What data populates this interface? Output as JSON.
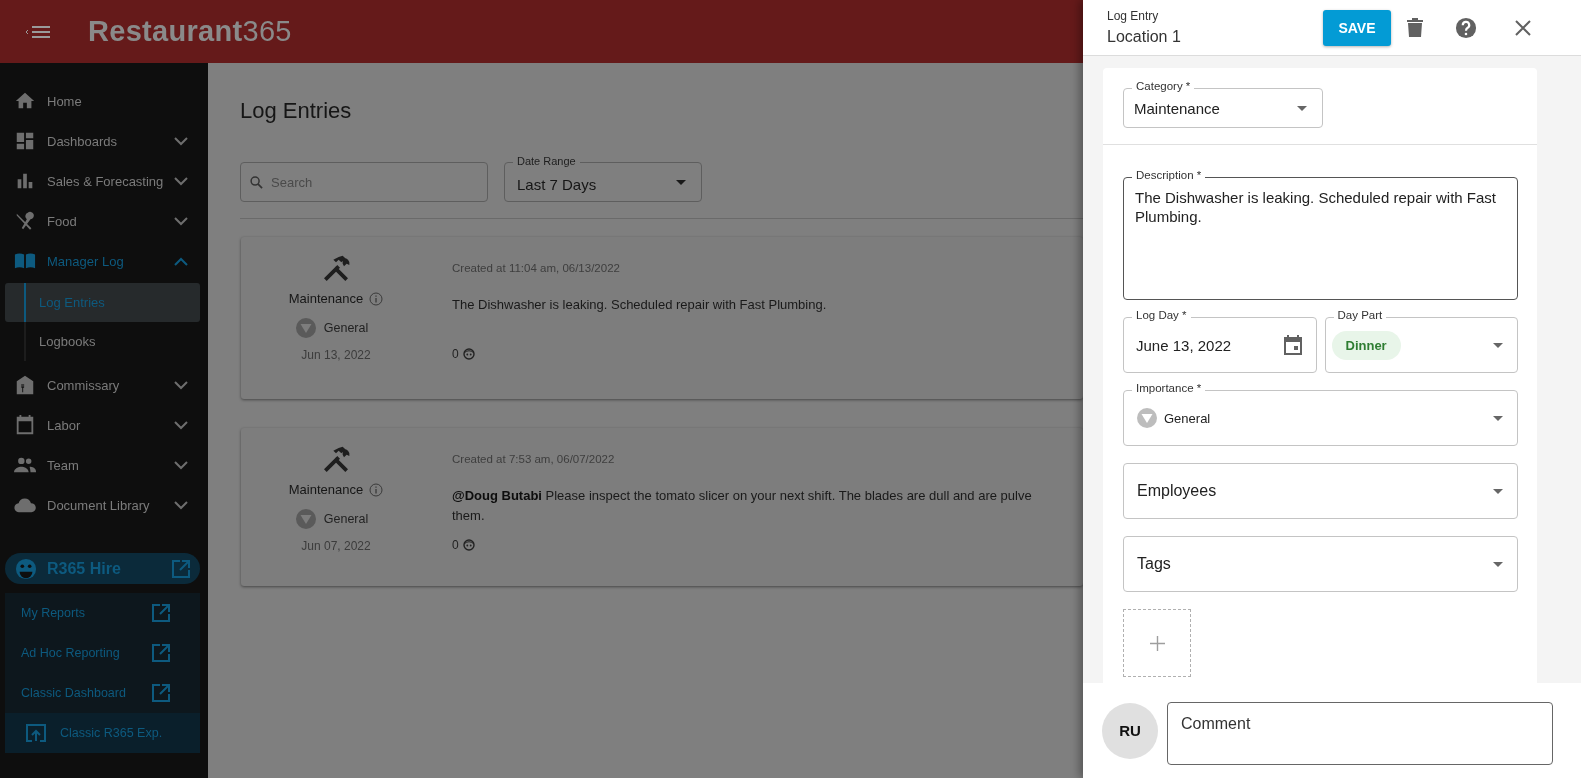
{
  "header": {
    "logo": "**Restaurant**365"
  },
  "sidebar": {
    "items": [
      {
        "label": "Home",
        "kind": "link",
        "selected": false
      },
      {
        "label": "Dashboards",
        "kind": "group",
        "expanded": false,
        "selected": false
      },
      {
        "label": "Sales & Forecasting",
        "kind": "group",
        "expanded": false,
        "selected": false
      },
      {
        "label": "Food",
        "kind": "group",
        "expanded": false,
        "selected": false
      },
      {
        "label": "Manager Log",
        "kind": "group",
        "expanded": true,
        "selected": true,
        "children": [
          {
            "label": "Log Entries",
            "selected": true
          },
          {
            "label": "Logbooks",
            "selected": false
          }
        ]
      },
      {
        "label": "Commissary",
        "kind": "group",
        "expanded": false,
        "selected": false
      },
      {
        "label": "Labor",
        "kind": "group",
        "expanded": false,
        "selected": false
      },
      {
        "label": "Team",
        "kind": "group",
        "expanded": false,
        "selected": false
      },
      {
        "label": "Document Library",
        "kind": "group",
        "expanded": false,
        "selected": false
      }
    ],
    "hire": {
      "label": "R365 Hire"
    },
    "links": [
      {
        "label": "My Reports"
      },
      {
        "label": "Ad Hoc Reporting"
      },
      {
        "label": "Classic Dashboard"
      }
    ],
    "classic": {
      "label": "Classic R365 Exp."
    }
  },
  "main": {
    "title": "Log Entries",
    "search": {
      "placeholder": "Search"
    },
    "date_range": {
      "label": "Date Range",
      "value": "Last 7 Days"
    },
    "entries": [
      {
        "category": "Maintenance",
        "importance": "General",
        "date": "Jun 13, 2022",
        "created": "Created at 11:04 am, 06/13/2022",
        "message_lines": [
          "The Dishwasher is leaking. Scheduled repair with Fast Plumbing."
        ],
        "comments": "0"
      },
      {
        "category": "Maintenance",
        "importance": "General",
        "date": "Jun 07, 2022",
        "created": "Created at 7:53 am, 06/07/2022",
        "message_lines": [
          "**@Doug Butabi** Please inspect the tomato slicer on your next shift. The blades are dull and are pulve",
          "them."
        ],
        "comments": "0"
      }
    ]
  },
  "drawer": {
    "subtitle": "Log Entry",
    "title": "Location 1",
    "save": "SAVE",
    "category": {
      "label": "Category *",
      "value": "Maintenance"
    },
    "description": {
      "label": "Description *",
      "value": "The Dishwasher is leaking. Scheduled repair with Fast Plumbing."
    },
    "log_day": {
      "label": "Log Day *",
      "value": "June 13, 2022"
    },
    "day_part": {
      "label": "Day Part",
      "value": "Dinner"
    },
    "importance": {
      "label": "Importance *",
      "value": "General"
    },
    "employees": {
      "placeholder": "Employees"
    },
    "tags": {
      "placeholder": "Tags"
    },
    "avatar": "RU",
    "comment": {
      "placeholder": "Comment"
    }
  }
}
